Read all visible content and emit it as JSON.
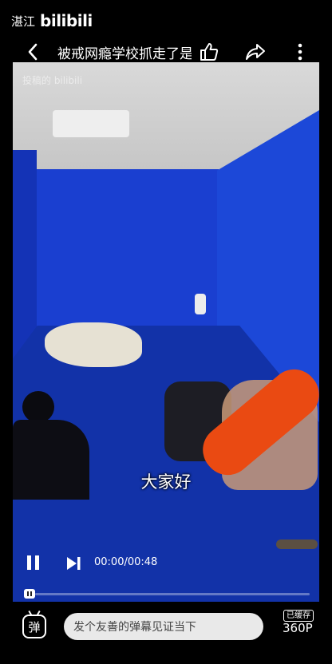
{
  "status_bar": {
    "location": "湛江",
    "app_logo": "bilibili"
  },
  "topbar": {
    "title": "被戒网瘾学校抓走了是",
    "back_icon": "chevron-left-icon",
    "like_icon": "thumbs-up-icon",
    "share_icon": "share-arrow-icon",
    "more_icon": "more-vertical-icon"
  },
  "video": {
    "watermark": "投稿的 bilibili",
    "subtitle": "大家好",
    "scene_colors": {
      "wall": "#1a3fd0",
      "floor": "#1232a8",
      "punching_bag": "#ea4a12"
    }
  },
  "player": {
    "time": "00:00/00:48",
    "progress": 0.0,
    "pause_icon": "pause-icon",
    "next_icon": "skip-next-icon"
  },
  "bottombar": {
    "danmaku_label": "弹",
    "danmaku_placeholder": "发个友善的弹幕见证当下",
    "cache_badge": "已缓存",
    "quality": "360P"
  }
}
